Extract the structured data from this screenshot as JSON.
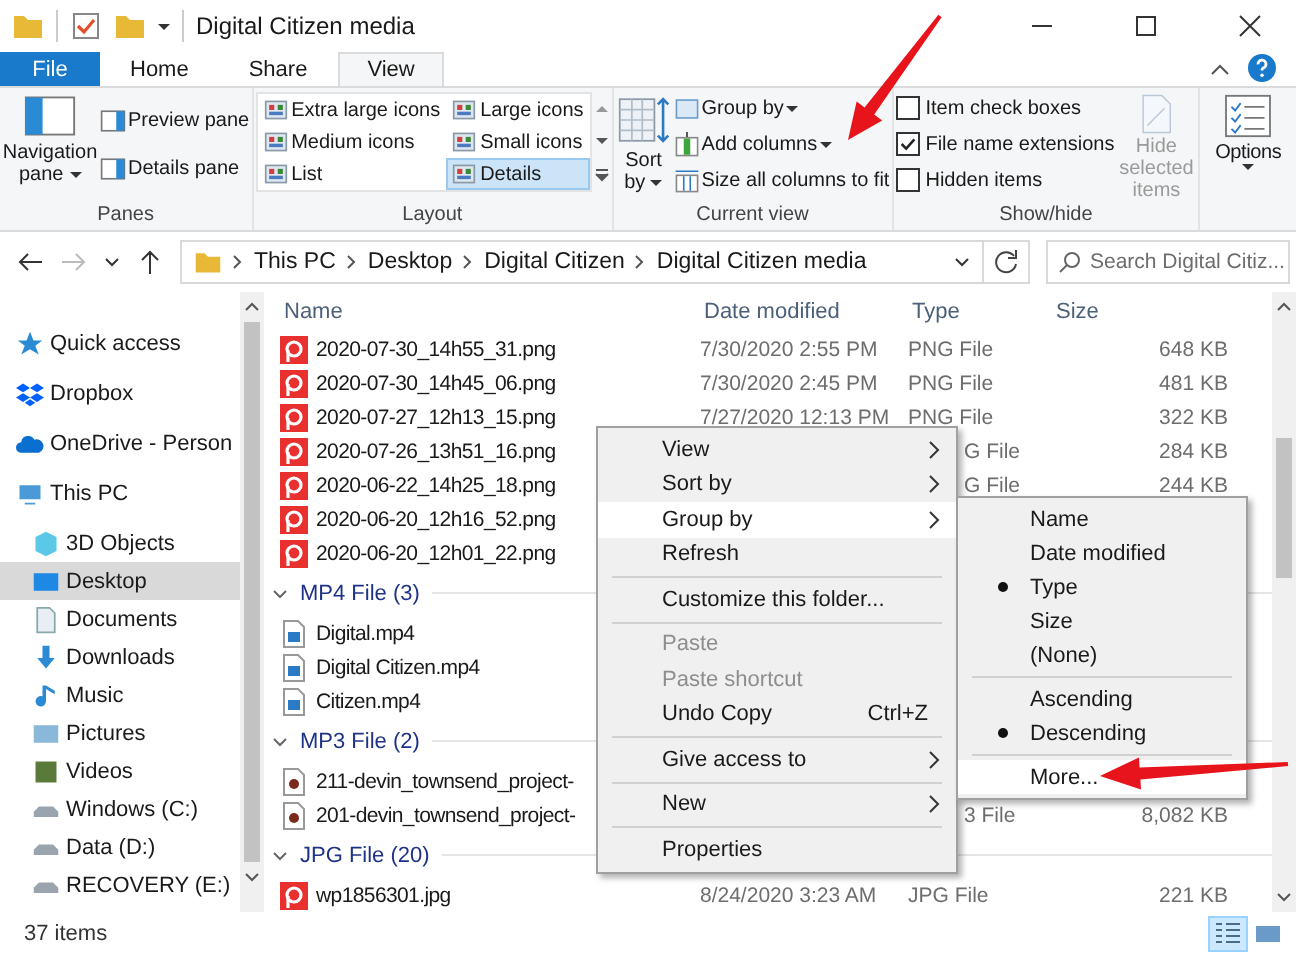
{
  "window": {
    "title": "Digital Citizen media"
  },
  "ribbon": {
    "tabs": [
      {
        "label": "File",
        "kind": "file",
        "selected": false
      },
      {
        "label": "Home",
        "kind": "tab",
        "selected": false
      },
      {
        "label": "Share",
        "kind": "tab",
        "selected": false
      },
      {
        "label": "View",
        "kind": "tab",
        "selected": true
      }
    ],
    "panes": {
      "label": "Panes",
      "navigation_pane": "Navigation pane",
      "preview_pane": "Preview pane",
      "details_pane": "Details pane"
    },
    "layout": {
      "label": "Layout",
      "options": [
        {
          "label": "Extra large icons",
          "selected": false
        },
        {
          "label": "Large icons",
          "selected": false
        },
        {
          "label": "Medium icons",
          "selected": false
        },
        {
          "label": "Small icons",
          "selected": false
        },
        {
          "label": "List",
          "selected": false
        },
        {
          "label": "Details",
          "selected": true
        }
      ]
    },
    "current_view": {
      "label": "Current view",
      "sort_by": "Sort by",
      "group_by": "Group by",
      "add_columns": "Add columns",
      "size_columns": "Size all columns to fit"
    },
    "show_hide": {
      "label": "Show/hide",
      "checkboxes": [
        {
          "label": "Item check boxes",
          "checked": false
        },
        {
          "label": "File name extensions",
          "checked": true
        },
        {
          "label": "Hidden items",
          "checked": false
        }
      ],
      "hide_selected": {
        "label": "Hide selected items",
        "disabled": true
      }
    },
    "options": "Options"
  },
  "address": {
    "path": [
      "This PC",
      "Desktop",
      "Digital Citizen",
      "Digital Citizen media"
    ],
    "search_placeholder": "Search Digital Citiz..."
  },
  "nav": [
    {
      "label": "Quick access",
      "kind": "star",
      "selected": false
    },
    {
      "label": "Dropbox",
      "kind": "dropbox",
      "selected": false
    },
    {
      "label": "OneDrive - Person",
      "kind": "cloud",
      "selected": false
    },
    {
      "label": "This PC",
      "kind": "pc",
      "selected": false,
      "children": [
        {
          "label": "3D Objects",
          "kind": "cube",
          "selected": false
        },
        {
          "label": "Desktop",
          "kind": "desktop",
          "selected": true
        },
        {
          "label": "Documents",
          "kind": "document",
          "selected": false
        },
        {
          "label": "Downloads",
          "kind": "download",
          "selected": false
        },
        {
          "label": "Music",
          "kind": "music",
          "selected": false
        },
        {
          "label": "Pictures",
          "kind": "pictures",
          "selected": false
        },
        {
          "label": "Videos",
          "kind": "videos",
          "selected": false
        },
        {
          "label": "Windows (C:)",
          "kind": "drive",
          "selected": false
        },
        {
          "label": "Data (D:)",
          "kind": "drive",
          "selected": false
        },
        {
          "label": "RECOVERY (E:)",
          "kind": "drive",
          "selected": false
        }
      ]
    }
  ],
  "files": {
    "columns": [
      "Name",
      "Date modified",
      "Type",
      "Size"
    ],
    "sections": [
      {
        "rows": [
          {
            "name": "2020-07-30_14h55_31.png",
            "kind": "image",
            "date": "7/30/2020 2:55 PM",
            "type": "PNG File",
            "size": "648 KB"
          },
          {
            "name": "2020-07-30_14h45_06.png",
            "kind": "image",
            "date": "7/30/2020 2:45 PM",
            "type": "PNG File",
            "size": "481 KB"
          },
          {
            "name": "2020-07-27_12h13_15.png",
            "kind": "image",
            "date": "7/27/2020 12:13 PM",
            "type": "PNG File",
            "size": "322 KB"
          },
          {
            "name": "2020-07-26_13h51_16.png",
            "kind": "image",
            "type": "G File",
            "type_covered": true,
            "size": "284 KB"
          },
          {
            "name": "2020-06-22_14h25_18.png",
            "kind": "image",
            "type": "G File",
            "type_covered": true,
            "size": "244 KB"
          },
          {
            "name": "2020-06-20_12h16_52.png",
            "kind": "image"
          },
          {
            "name": "2020-06-20_12h01_22.png",
            "kind": "image"
          }
        ]
      },
      {
        "title": "MP4 File (3)",
        "rows": [
          {
            "name": "Digital.mp4",
            "kind": "video"
          },
          {
            "name": "Digital Citizen.mp4",
            "kind": "video"
          },
          {
            "name": "Citizen.mp4",
            "kind": "video"
          }
        ]
      },
      {
        "title": "MP3 File (2)",
        "rows": [
          {
            "name": "211-devin_townsend_project-",
            "kind": "audio"
          },
          {
            "name": "201-devin_townsend_project-",
            "kind": "audio",
            "type": "3 File",
            "type_covered": true,
            "size": "8,082 KB"
          }
        ]
      },
      {
        "title": "JPG File (20)",
        "rows": [
          {
            "name": "wp1856301.jpg",
            "kind": "image",
            "date": "8/24/2020 3:23 AM",
            "type": "JPG File",
            "size": "221 KB"
          }
        ]
      }
    ]
  },
  "context_menu": {
    "items": [
      {
        "kind": "submenu",
        "label": "View",
        "highlighted": false,
        "disabled": false
      },
      {
        "kind": "submenu",
        "label": "Sort by",
        "highlighted": false,
        "disabled": false
      },
      {
        "kind": "submenu",
        "label": "Group by",
        "highlighted": true,
        "disabled": false
      },
      {
        "kind": "item",
        "label": "Refresh",
        "highlighted": false,
        "disabled": false
      },
      {
        "kind": "separator"
      },
      {
        "kind": "item",
        "label": "Customize this folder...",
        "highlighted": false,
        "disabled": false
      },
      {
        "kind": "separator"
      },
      {
        "kind": "item",
        "label": "Paste",
        "highlighted": false,
        "disabled": true
      },
      {
        "kind": "item",
        "label": "Paste shortcut",
        "highlighted": false,
        "disabled": true
      },
      {
        "kind": "item",
        "label": "Undo Copy",
        "shortcut": "Ctrl+Z",
        "highlighted": false,
        "disabled": false
      },
      {
        "kind": "separator"
      },
      {
        "kind": "submenu",
        "label": "Give access to",
        "highlighted": false,
        "disabled": false
      },
      {
        "kind": "separator"
      },
      {
        "kind": "submenu",
        "label": "New",
        "highlighted": false,
        "disabled": false
      },
      {
        "kind": "separator"
      },
      {
        "kind": "item",
        "label": "Properties",
        "highlighted": false,
        "disabled": false
      }
    ]
  },
  "submenu": {
    "items": [
      {
        "kind": "item",
        "label": "Name",
        "checked": false,
        "highlighted": false
      },
      {
        "kind": "item",
        "label": "Date modified",
        "checked": false,
        "highlighted": false
      },
      {
        "kind": "item",
        "label": "Type",
        "checked": true,
        "highlighted": false
      },
      {
        "kind": "item",
        "label": "Size",
        "checked": false,
        "highlighted": false
      },
      {
        "kind": "item",
        "label": "(None)",
        "checked": false,
        "highlighted": false
      },
      {
        "kind": "separator"
      },
      {
        "kind": "item",
        "label": "Ascending",
        "checked": false,
        "highlighted": false
      },
      {
        "kind": "item",
        "label": "Descending",
        "checked": true,
        "highlighted": false
      },
      {
        "kind": "separator"
      },
      {
        "kind": "item",
        "label": "More...",
        "checked": false,
        "highlighted": true
      }
    ]
  },
  "status_bar": {
    "count": "37 items",
    "views": [
      {
        "kind": "details",
        "selected": true
      },
      {
        "kind": "tiles",
        "selected": false
      }
    ]
  }
}
